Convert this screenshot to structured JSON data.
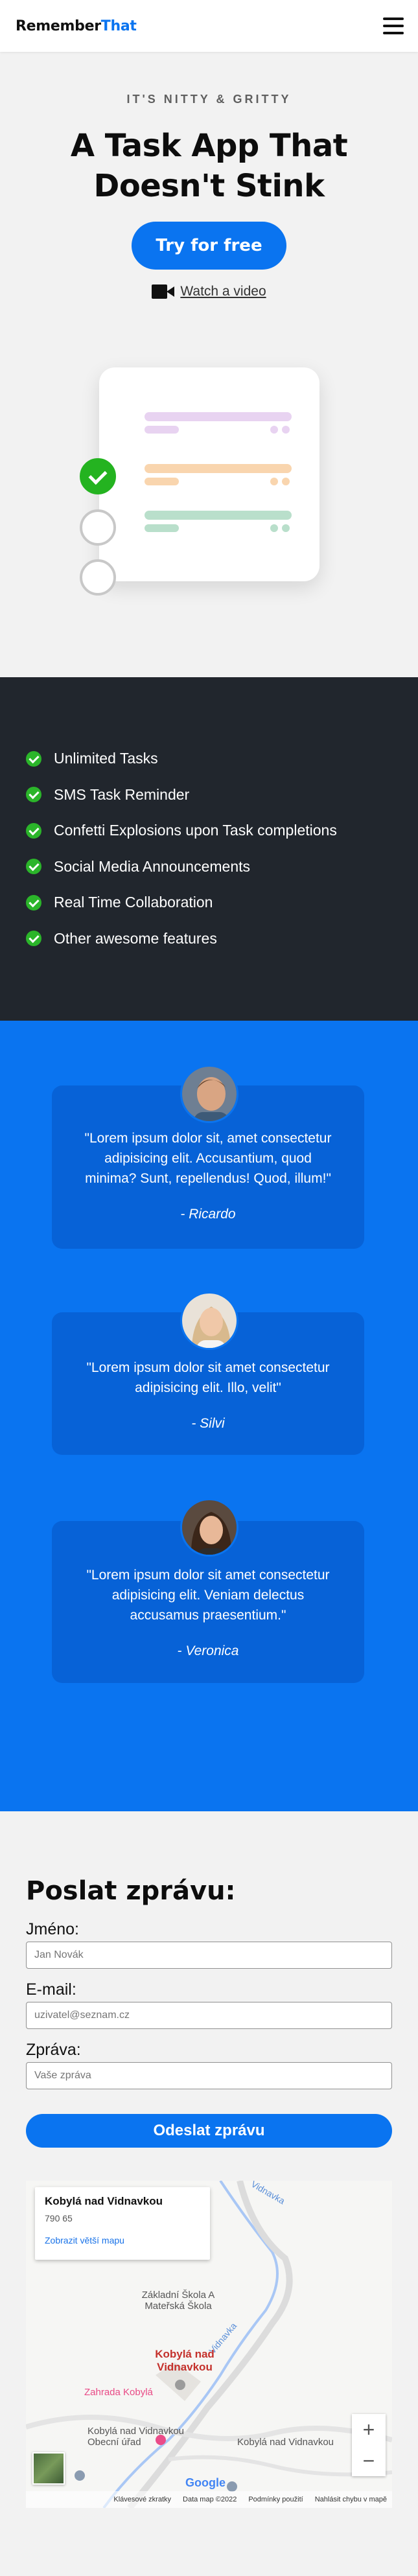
{
  "header": {
    "logo_part1": "Remember",
    "logo_part2": "That"
  },
  "hero": {
    "tagline": "IT'S NITTY & GRITTY",
    "title_line1": "A Task App That",
    "title_line2": "Doesn't Stink",
    "cta_label": "Try for free",
    "watch_label": "Watch a video",
    "colors": {
      "accent": "#0a74f0",
      "check": "#24b320"
    },
    "tasks": [
      {
        "checked": true,
        "bar_color": "#e8d3f1",
        "dot_color": "#e8d3f1"
      },
      {
        "checked": false,
        "bar_color": "#f9d5ae",
        "dot_color": "#f9d5ae"
      },
      {
        "checked": false,
        "bar_color": "#b9dfcb",
        "dot_color": "#b9dfcb"
      }
    ]
  },
  "features": {
    "items": [
      "Unlimited Tasks",
      "SMS Task Reminder",
      "Confetti Explosions upon Task completions",
      "Social Media Announcements",
      "Real Time Collaboration",
      "Other awesome features"
    ]
  },
  "testimonials": [
    {
      "quote": "\"Lorem ipsum dolor sit, amet consectetur adipisicing elit. Accusantium, quod minima? Sunt, repellendus! Quod, illum!\"",
      "author": "- Ricardo"
    },
    {
      "quote": "\"Lorem ipsum dolor sit amet consectetur adipisicing elit. Illo, velit\"",
      "author": "- Silvi"
    },
    {
      "quote": "\"Lorem ipsum dolor sit amet consectetur adipisicing elit. Veniam delectus accusamus praesentium.\"",
      "author": "- Veronica"
    }
  ],
  "form": {
    "title": "Poslat zprávu:",
    "name_label": "Jméno:",
    "name_placeholder": "Jan Novák",
    "email_label": "E-mail:",
    "email_placeholder": "uzivatel@seznam.cz",
    "message_label": "Zpráva:",
    "message_placeholder": "Vaše zpráva",
    "submit_label": "Odeslat zprávu"
  },
  "map": {
    "place_name": "Kobylá nad Vidnavkou",
    "zip": "790 65",
    "larger_map_link": "Zobrazit větší mapu",
    "poi_school": "Základní Škola A Mateřská Škola",
    "poi_village": "Kobylá nad Vidnavkou",
    "poi_garden": "Zahrada Kobylá",
    "poi_office": "Kobylá nad Vidnavkou Obecní úřad",
    "poi_office2": "Kobylá nad Vidnavkou",
    "river": "Vidnavka",
    "river2": "Vidnavka",
    "zoom_in": "+",
    "zoom_out": "−",
    "brand": "Google",
    "footer": [
      "Klávesové zkratky",
      "Data map ©2022",
      "Podmínky použití",
      "Nahlásit chybu v mapě"
    ]
  }
}
